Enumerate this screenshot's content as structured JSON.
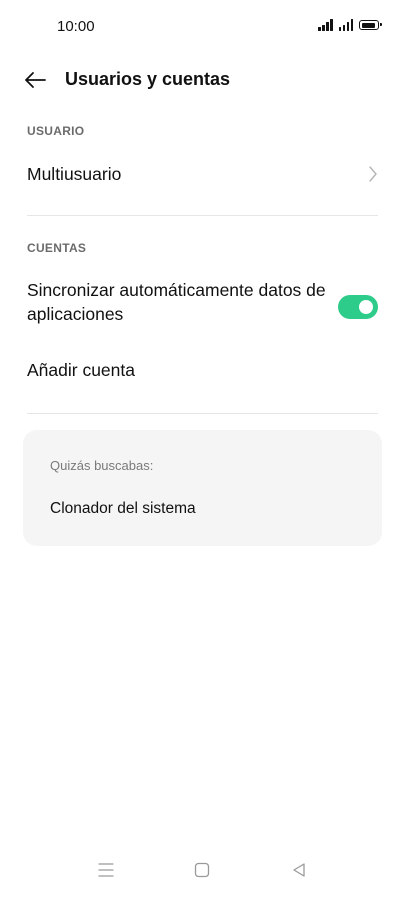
{
  "status_bar": {
    "time": "10:00"
  },
  "header": {
    "title": "Usuarios y cuentas"
  },
  "sections": {
    "user": {
      "label": "USUARIO",
      "items": [
        {
          "label": "Multiusuario"
        }
      ]
    },
    "accounts": {
      "label": "CUENTAS",
      "sync": {
        "label": "Sincronizar automáticamente datos de aplicaciones",
        "enabled": true
      },
      "add_account": {
        "label": "Añadir cuenta"
      }
    }
  },
  "suggestions": {
    "header": "Quizás buscabas:",
    "items": [
      {
        "label": "Clonador del sistema"
      }
    ]
  },
  "colors": {
    "toggle_on": "#2ecc8a",
    "card_bg": "#f5f5f5"
  }
}
